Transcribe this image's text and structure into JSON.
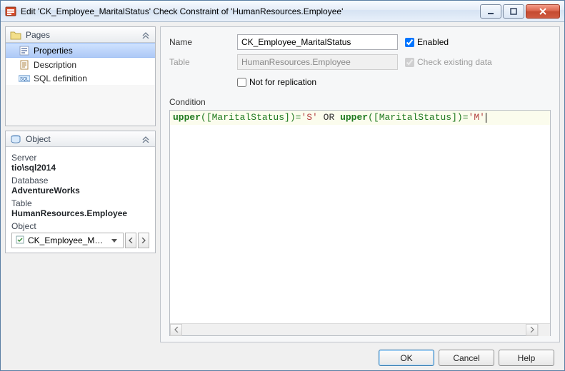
{
  "titlebar": {
    "title": "Edit 'CK_Employee_MaritalStatus' Check Constraint of 'HumanResources.Employee'"
  },
  "left": {
    "pages": {
      "title": "Pages",
      "items": [
        {
          "label": "Properties",
          "icon": "properties-icon",
          "selected": true
        },
        {
          "label": "Description",
          "icon": "description-icon",
          "selected": false
        },
        {
          "label": "SQL definition",
          "icon": "sql-icon",
          "selected": false
        }
      ]
    },
    "object": {
      "title": "Object",
      "server_label": "Server",
      "server_value": "tio\\sql2014",
      "database_label": "Database",
      "database_value": "AdventureWorks",
      "table_label": "Table",
      "table_value": "HumanResources.Employee",
      "object_label": "Object",
      "select_value": "CK_Employee_MaritalSt…"
    }
  },
  "form": {
    "name_label": "Name",
    "name_value": "CK_Employee_MaritalStatus",
    "enabled_label": "Enabled",
    "enabled_checked": true,
    "table_label": "Table",
    "table_value": "HumanResources.Employee",
    "check_existing_label": "Check existing data",
    "check_existing_checked": true,
    "not_for_replication_label": "Not for replication",
    "not_for_replication_checked": false,
    "condition_label": "Condition",
    "condition_parts": {
      "p1": "upper",
      "p2": "([MaritalStatus])=",
      "p3": "'S'",
      "p4": " OR ",
      "p5": "upper",
      "p6": "([MaritalStatus])=",
      "p7": "'M'"
    }
  },
  "buttons": {
    "ok": "OK",
    "cancel": "Cancel",
    "help": "Help"
  },
  "chart_data": null
}
